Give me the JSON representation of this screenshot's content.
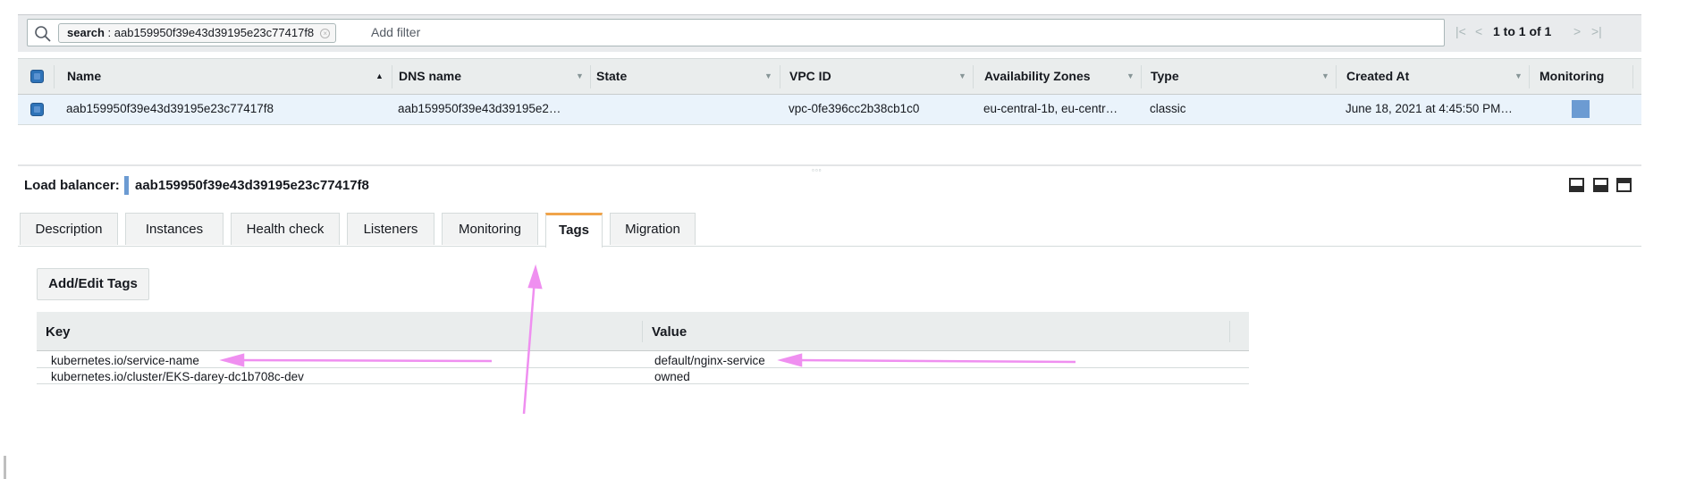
{
  "filter": {
    "token_key": "search",
    "token_value": "aab159950f39e43d39195e23c77417f8",
    "add_filter_placeholder": "Add filter"
  },
  "pagination": {
    "text": "1 to 1 of 1"
  },
  "table": {
    "columns": [
      "Name",
      "DNS name",
      "State",
      "VPC ID",
      "Availability Zones",
      "Type",
      "Created At",
      "Monitoring"
    ],
    "rows": [
      {
        "name": "aab159950f39e43d39195e23c77417f8",
        "dns_name": "aab159950f39e43d39195e2…",
        "state": "",
        "vpc_id": "vpc-0fe396cc2b38cb1c0",
        "availability_zones": "eu-central-1b, eu-centr…",
        "type": "classic",
        "created_at": "June 18, 2021 at 4:45:50 PM…"
      }
    ]
  },
  "detail": {
    "label": "Load balancer:",
    "name": "aab159950f39e43d39195e23c77417f8",
    "tabs": [
      "Description",
      "Instances",
      "Health check",
      "Listeners",
      "Monitoring",
      "Tags",
      "Migration"
    ],
    "active_tab": "Tags",
    "add_edit_button": "Add/Edit Tags",
    "tags_table": {
      "columns": [
        "Key",
        "Value"
      ],
      "rows": [
        {
          "key": "kubernetes.io/service-name",
          "value": "default/nginx-service"
        },
        {
          "key": "kubernetes.io/cluster/EKS-darey-dc1b708c-dev",
          "value": "owned"
        }
      ]
    }
  },
  "colors": {
    "accent_tab": "#f0a44a",
    "checkbox": "#2e73b8",
    "annotation_arrow": "#ef8ff0"
  }
}
